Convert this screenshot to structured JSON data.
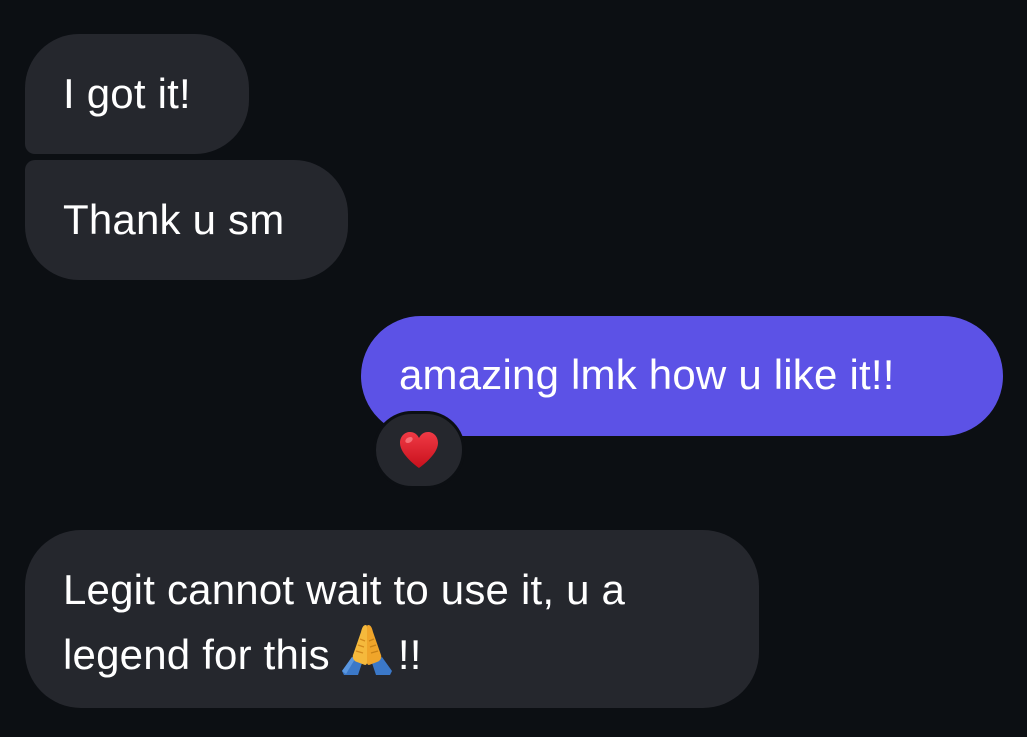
{
  "conversation": {
    "messages": [
      {
        "sender": "them",
        "text": "I got it!"
      },
      {
        "sender": "them",
        "text": "Thank u sm"
      },
      {
        "sender": "me",
        "text": "amazing lmk how u like it!!",
        "reaction": "❤️"
      },
      {
        "sender": "them",
        "line1": "Legit cannot wait to use it, u a",
        "line2_before": "legend for this",
        "emoji": "🙏",
        "line2_after": "!!"
      }
    ]
  },
  "colors": {
    "background": "#0c0f13",
    "incoming_bubble": "#25272d",
    "outgoing_bubble": "#5c52e6",
    "text": "#ffffff",
    "reaction_heart": "#e0212e"
  },
  "icons": {
    "reaction": "red-heart-icon",
    "inline_emoji": "folded-hands-icon"
  }
}
